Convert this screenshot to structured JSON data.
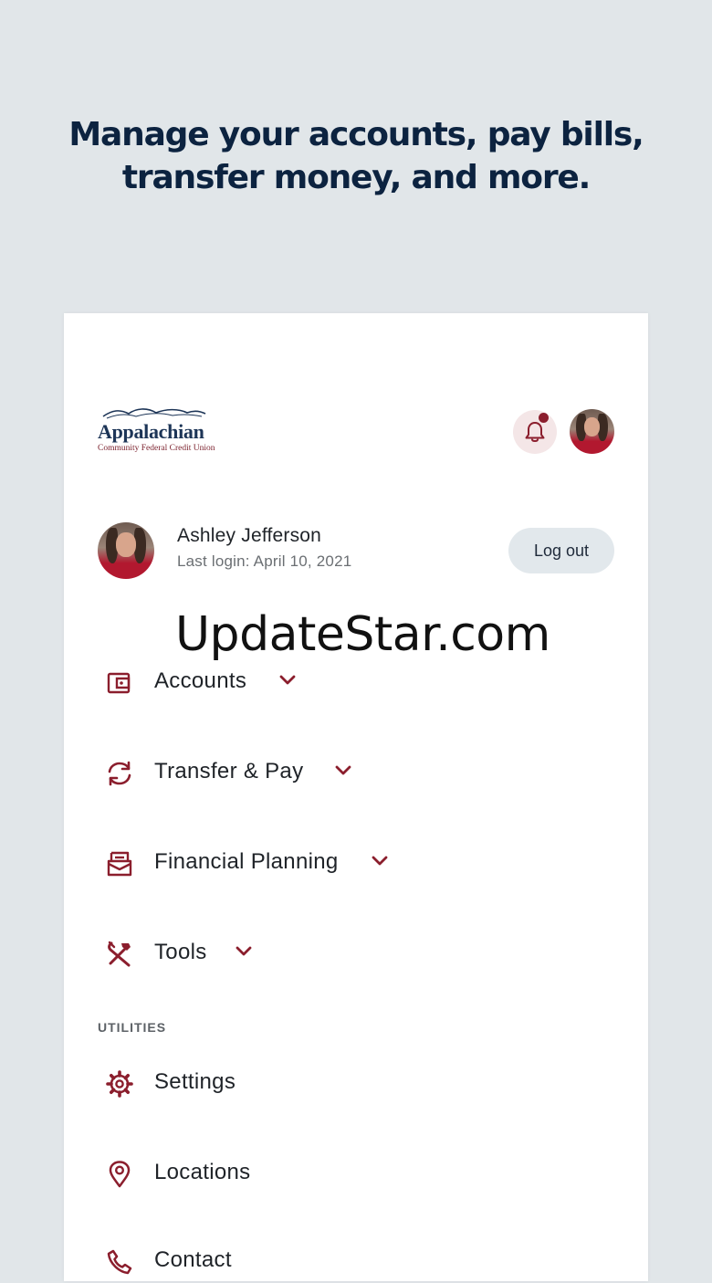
{
  "headline": {
    "line1": "Manage your accounts, pay bills,",
    "line2": "transfer money, and more."
  },
  "header": {
    "logo_name": "Appalachian",
    "logo_subtitle": "Community Federal Credit Union",
    "notifications_icon": "bell-icon",
    "has_unread_notification": true
  },
  "profile": {
    "name": "Ashley Jefferson",
    "last_login": "Last login: April 10, 2021",
    "logout_label": "Log out"
  },
  "watermark": "UpdateStar.com",
  "nav": {
    "items": [
      {
        "label": "Accounts",
        "icon": "wallet-icon",
        "expandable": true
      },
      {
        "label": "Transfer & Pay",
        "icon": "transfer-icon",
        "expandable": true
      },
      {
        "label": "Financial Planning",
        "icon": "planning-icon",
        "expandable": true
      },
      {
        "label": "Tools",
        "icon": "tools-icon",
        "expandable": true
      }
    ]
  },
  "utilities": {
    "section_label": "UTILITIES",
    "items": [
      {
        "label": "Settings",
        "icon": "gear-icon"
      },
      {
        "label": "Locations",
        "icon": "location-pin-icon"
      },
      {
        "label": "Contact",
        "icon": "phone-icon"
      }
    ]
  },
  "colors": {
    "background": "#e1e6e9",
    "headline": "#0c2340",
    "accent": "#8b1e2d",
    "button_bg": "#e2e8ec"
  }
}
